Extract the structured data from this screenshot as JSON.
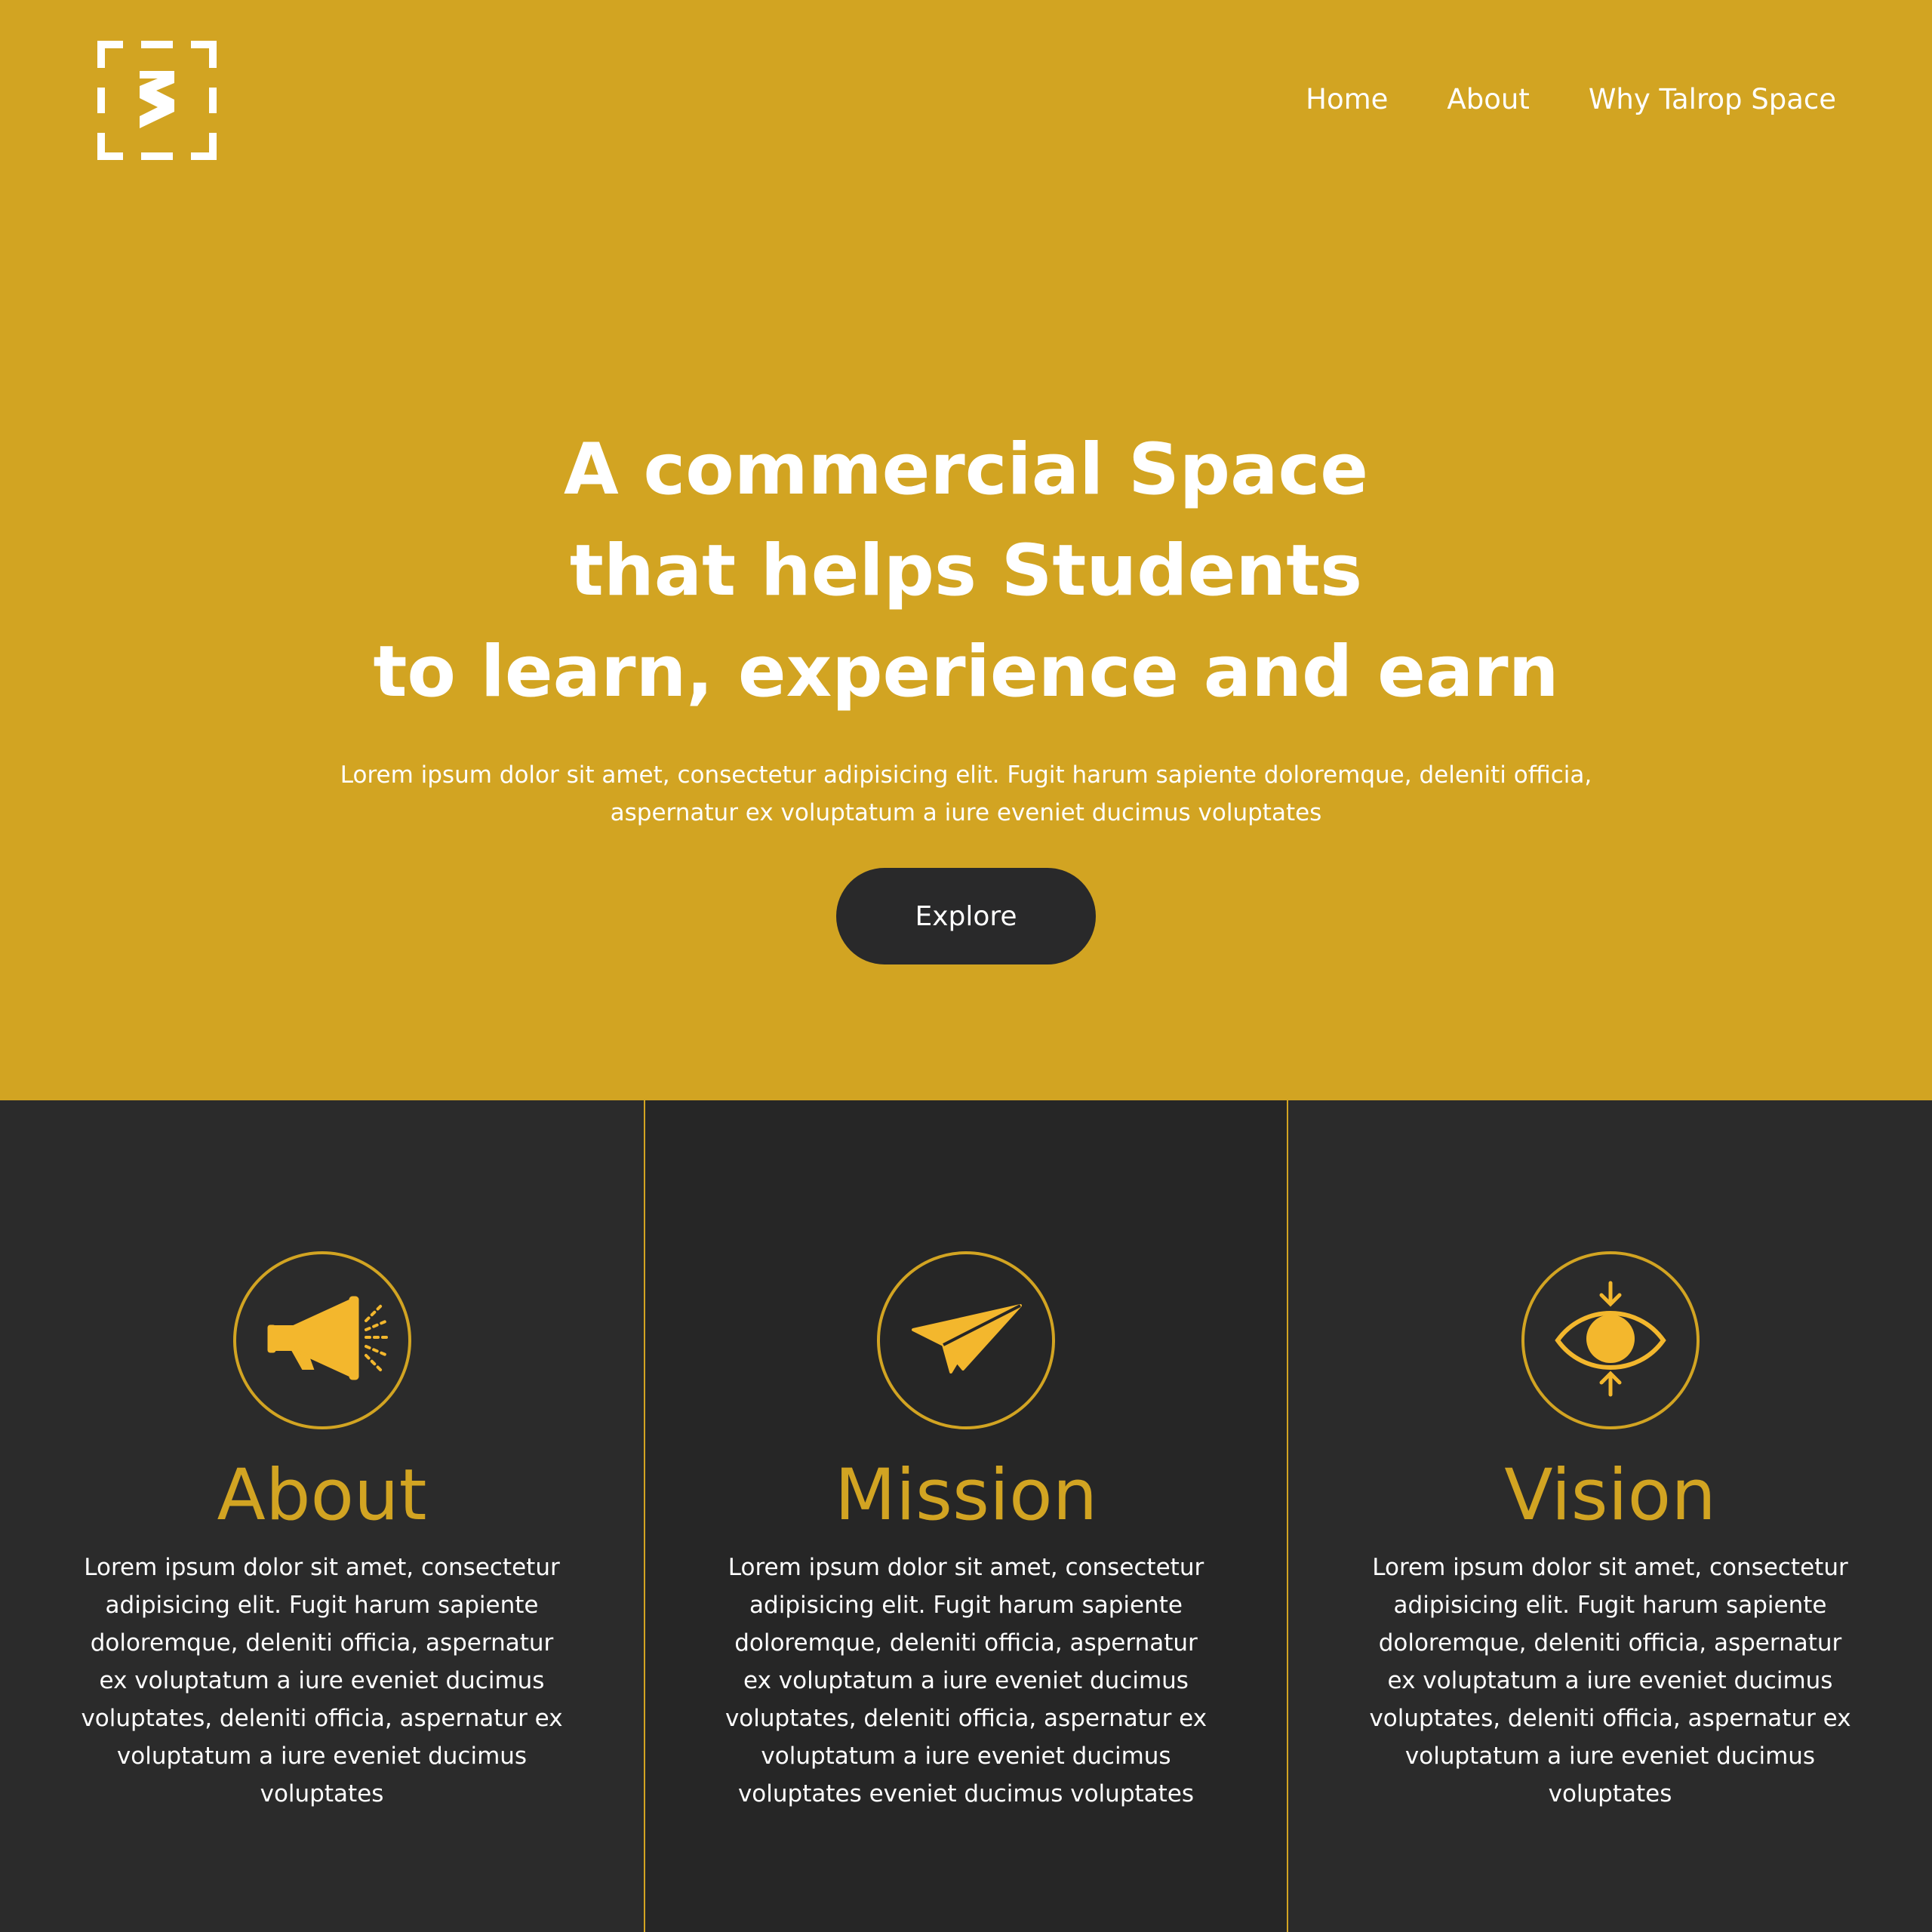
{
  "header": {
    "logo_name": "talrop-space-logo",
    "nav": [
      {
        "label": "Home"
      },
      {
        "label": "About"
      },
      {
        "label": "Why Talrop Space"
      }
    ]
  },
  "hero": {
    "headline_lines": [
      "A commercial Space",
      "that helps Students",
      "to learn, experience and earn"
    ],
    "description": "Lorem ipsum dolor sit amet, consectetur adipisicing elit. Fugit harum sapiente doloremque, deleniti officia, aspernatur ex voluptatum a iure eveniet ducimus voluptates",
    "cta_label": "Explore"
  },
  "features": [
    {
      "icon": "megaphone-icon",
      "title": "About",
      "text": "Lorem ipsum dolor sit amet, consectetur adipisicing elit. Fugit harum sapiente doloremque, deleniti officia, aspernatur ex voluptatum a iure eveniet ducimus voluptates, deleniti officia, aspernatur ex voluptatum a iure eveniet ducimus voluptates"
    },
    {
      "icon": "paper-plane-icon",
      "title": "Mission",
      "text": "Lorem ipsum dolor sit amet, consectetur adipisicing elit. Fugit harum sapiente doloremque, deleniti officia, aspernatur ex voluptatum a iure eveniet ducimus voluptates, deleniti officia, aspernatur ex voluptatum a iure eveniet ducimus voluptates eveniet ducimus voluptates"
    },
    {
      "icon": "eye-icon",
      "title": "Vision",
      "text": "Lorem ipsum dolor sit amet, consectetur adipisicing elit. Fugit harum sapiente doloremque, deleniti officia, aspernatur ex voluptatum a iure eveniet ducimus voluptates, deleniti officia, aspernatur ex voluptatum a iure eveniet ducimus voluptates"
    }
  ],
  "colors": {
    "accent_gold": "#d2a422",
    "icon_gold": "#f3b72d",
    "dark_bg": "#2b2b2b",
    "dark_bg_alt": "#262626",
    "button_dark": "#29292a",
    "text_white": "#ffffff"
  }
}
